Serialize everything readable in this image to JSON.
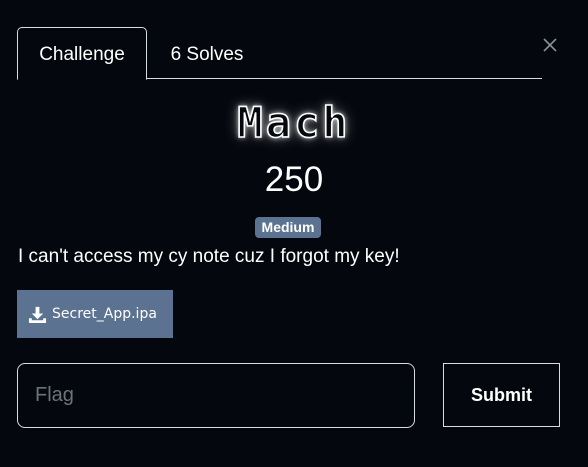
{
  "tabs": [
    {
      "label": "Challenge",
      "active": true
    },
    {
      "label": "6 Solves",
      "active": false
    }
  ],
  "challenge": {
    "name": "Mach",
    "points": "250",
    "difficulty": "Medium",
    "description": "I can't access my cy note cuz I forgot my key!",
    "file": {
      "name": "Secret_App.ipa",
      "icon": "download-icon"
    }
  },
  "flag_input": {
    "placeholder": "Flag",
    "value": ""
  },
  "submit_label": "Submit",
  "close_icon": "close-icon",
  "colors": {
    "background": "#04070d",
    "badge": "#5b7290",
    "file_button": "#5b7290",
    "border": "#d8dde3"
  }
}
